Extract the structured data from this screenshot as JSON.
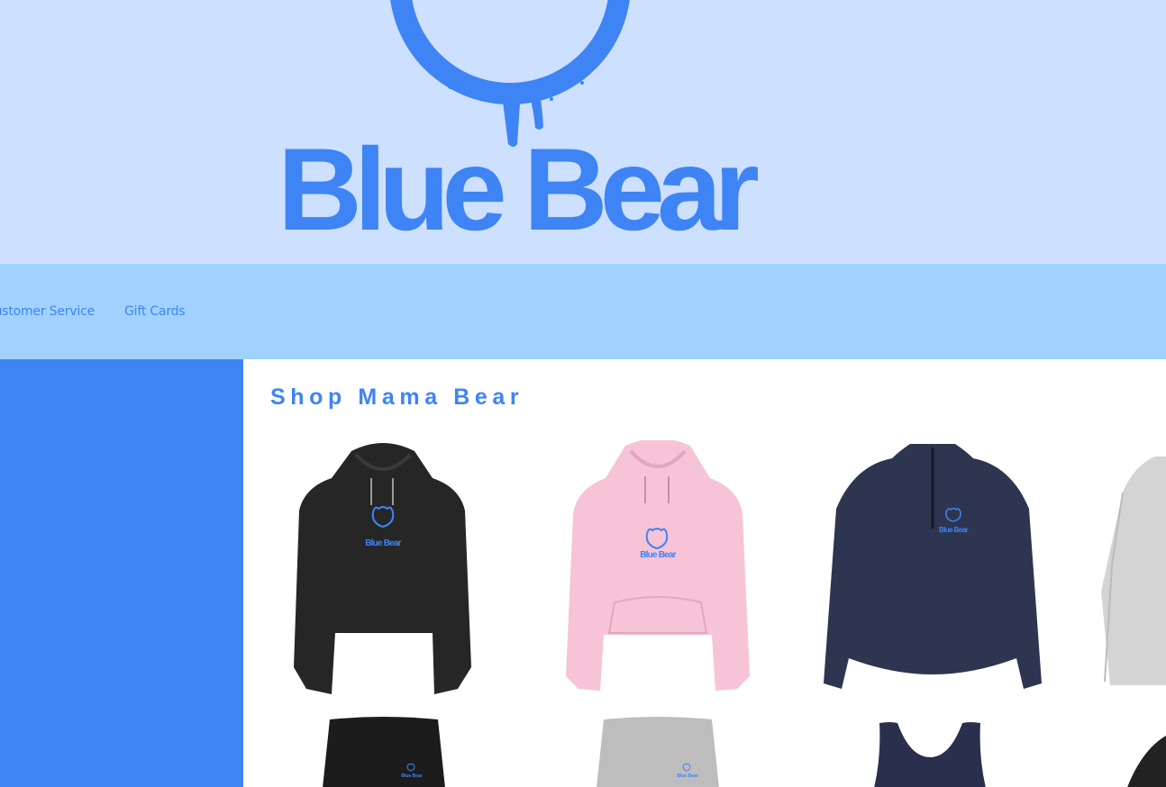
{
  "brand": {
    "name": "Blue Bear",
    "color": "#3e84f5"
  },
  "nav": {
    "links": [
      {
        "label": "Customer Service"
      },
      {
        "label": "Gift Cards"
      }
    ]
  },
  "main": {
    "title": "Shop Mama Bear",
    "products": [
      {
        "item": "black-hoodie",
        "color": "#262626",
        "logo_text": "Blue Bear"
      },
      {
        "item": "pink-hoodie",
        "color": "#f7c3d6",
        "logo_text": "Blue Bear"
      },
      {
        "item": "navy-quarter-zip",
        "color": "#2d3550",
        "logo_text": "Blue Bear"
      },
      {
        "item": "grey-long-sleeve",
        "color": "#d4d4d4"
      },
      {
        "item": "black-sweatpants",
        "color": "#1c1c1c",
        "logo_text": "Blue Bear"
      },
      {
        "item": "grey-sweatpants",
        "color": "#bdbdbd",
        "logo_text": "Blue Bear"
      },
      {
        "item": "navy-tank-top",
        "color": "#2a2f4e"
      },
      {
        "item": "black-top",
        "color": "#222222"
      }
    ]
  },
  "colors": {
    "header_bg": "#cde0ff",
    "nav_bg": "#a1d2ff",
    "sidebar_bg": "#3e84f5",
    "accent": "#3e84f5"
  }
}
